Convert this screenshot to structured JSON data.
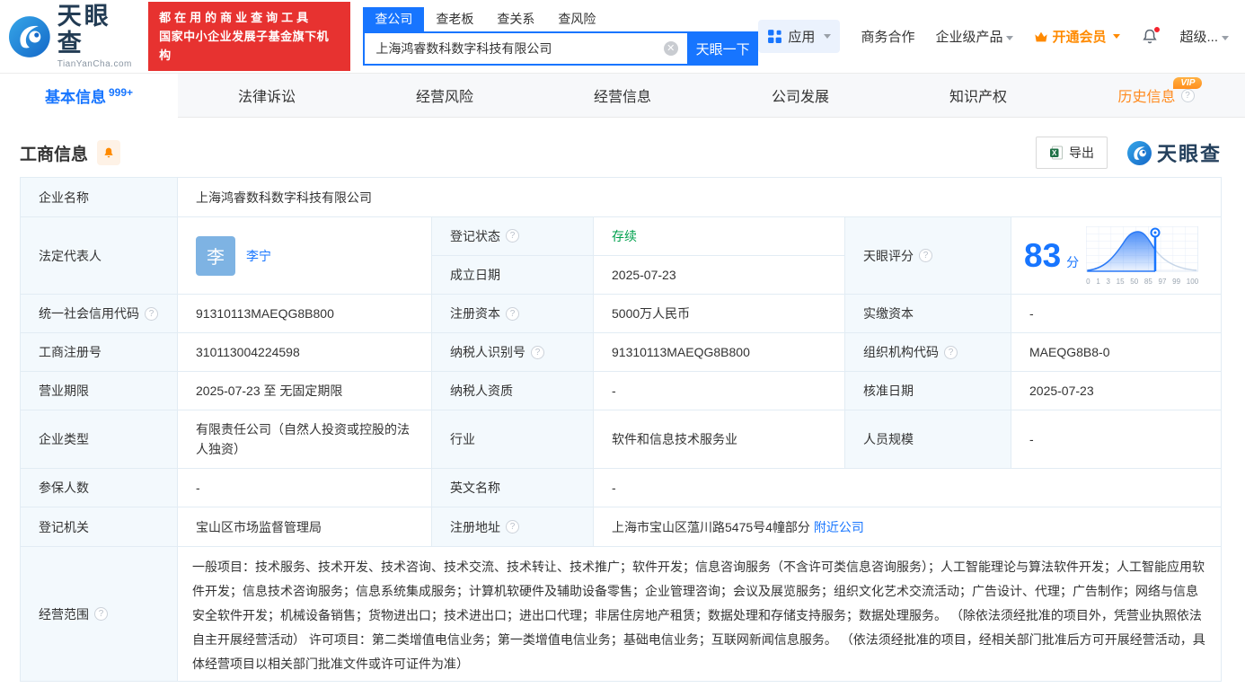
{
  "header": {
    "logo": {
      "title": "天眼查",
      "subtitle": "TianYanCha.com"
    },
    "promo": {
      "line1": "都在用的商业查询工具",
      "line2": "国家中小企业发展子基金旗下机构"
    },
    "search": {
      "tabs": [
        {
          "label": "查公司"
        },
        {
          "label": "查老板"
        },
        {
          "label": "查关系"
        },
        {
          "label": "查风险"
        }
      ],
      "value": "上海鸿睿数科数字科技有限公司",
      "button": "天眼一下"
    },
    "nav": {
      "apps": "应用",
      "cooperation": "商务合作",
      "enterprise": "企业级产品",
      "vip": "开通会员",
      "user": "超级..."
    }
  },
  "tabs": {
    "items": [
      {
        "label": "基本信息",
        "badge": "999+"
      },
      {
        "label": "法律诉讼"
      },
      {
        "label": "经营风险"
      },
      {
        "label": "经营信息"
      },
      {
        "label": "公司发展"
      },
      {
        "label": "知识产权"
      },
      {
        "label": "历史信息",
        "badge": "VIP"
      }
    ]
  },
  "section": {
    "title": "工商信息",
    "export": "导出",
    "watermark": "天眼查"
  },
  "score": {
    "label": "天眼评分",
    "value": "83",
    "unit": "分",
    "axis": [
      "0",
      "1",
      "3",
      "15",
      "50",
      "85",
      "97",
      "99",
      "100"
    ]
  },
  "biz": {
    "company_name": {
      "label": "企业名称",
      "value": "上海鸿睿数科数字科技有限公司"
    },
    "legal_rep": {
      "label": "法定代表人",
      "avatar": "李",
      "name": "李宁"
    },
    "reg_status": {
      "label": "登记状态",
      "value": "存续"
    },
    "establish_date": {
      "label": "成立日期",
      "value": "2025-07-23"
    },
    "credit_code": {
      "label": "统一社会信用代码",
      "value": "91310113MAEQG8B800"
    },
    "reg_capital": {
      "label": "注册资本",
      "value": "5000万人民币"
    },
    "paid_capital": {
      "label": "实缴资本",
      "value": "-"
    },
    "reg_number": {
      "label": "工商注册号",
      "value": "310113004224598"
    },
    "taxpayer_id": {
      "label": "纳税人识别号",
      "value": "91310113MAEQG8B800"
    },
    "org_code": {
      "label": "组织机构代码",
      "value": "MAEQG8B8-0"
    },
    "business_term": {
      "label": "营业期限",
      "value": "2025-07-23 至 无固定期限"
    },
    "taxpayer_quality": {
      "label": "纳税人资质",
      "value": "-"
    },
    "approval_date": {
      "label": "核准日期",
      "value": "2025-07-23"
    },
    "company_type": {
      "label": "企业类型",
      "value": "有限责任公司（自然人投资或控股的法人独资）"
    },
    "industry": {
      "label": "行业",
      "value": "软件和信息技术服务业"
    },
    "staff_size": {
      "label": "人员规模",
      "value": "-"
    },
    "insured_count": {
      "label": "参保人数",
      "value": "-"
    },
    "english_name": {
      "label": "英文名称",
      "value": "-"
    },
    "reg_authority": {
      "label": "登记机关",
      "value": "宝山区市场监督管理局"
    },
    "reg_address": {
      "label": "注册地址",
      "value": "上海市宝山区蕰川路5475号4幢部分",
      "link": "附近公司"
    },
    "business_scope": {
      "label": "经营范围",
      "value": "一般项目：技术服务、技术开发、技术咨询、技术交流、技术转让、技术推广；软件开发；信息咨询服务（不含许可类信息咨询服务）；人工智能理论与算法软件开发；人工智能应用软件开发；信息技术咨询服务；信息系统集成服务；计算机软硬件及辅助设备零售；企业管理咨询；会议及展览服务；组织文化艺术交流活动；广告设计、代理；广告制作；网络与信息安全软件开发；机械设备销售；货物进出口；技术进出口；进出口代理；非居住房地产租赁；数据处理和存储支持服务；数据处理服务。 （除依法须经批准的项目外，凭营业执照依法自主开展经营活动） 许可项目：第二类增值电信业务；第一类增值电信业务；基础电信业务；互联网新闻信息服务。 （依法须经批准的项目，经相关部门批准后方可开展经营活动，具体经营项目以相关部门批准文件或许可证件为准）"
    }
  }
}
